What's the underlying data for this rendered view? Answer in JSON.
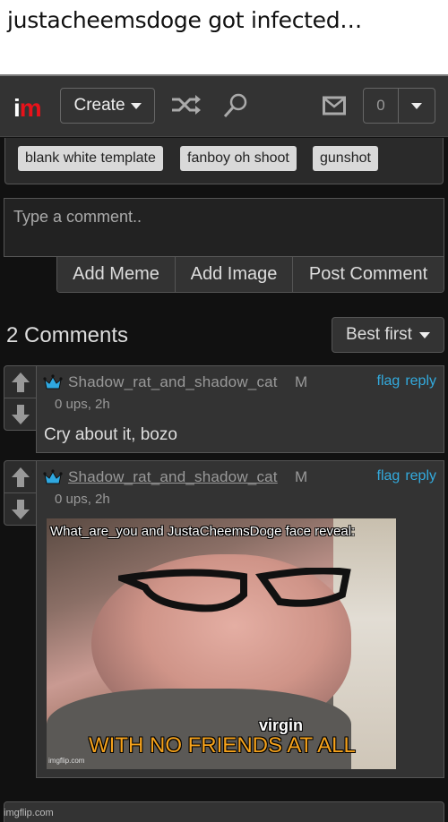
{
  "caption": "justacheemsdoge got infected…",
  "topbar": {
    "logo_i": "i",
    "logo_m": "m",
    "create_label": "Create",
    "icons": [
      "shuffle-icon",
      "search-icon",
      "mail-icon"
    ],
    "notification_count": "0"
  },
  "tags": [
    "blank white template",
    "fanboy oh shoot",
    "gunshot"
  ],
  "comment_form": {
    "placeholder": "Type a comment..",
    "buttons": [
      "Add Meme",
      "Add Image",
      "Post Comment"
    ]
  },
  "comments_header": {
    "count_label": "2 Comments",
    "sort_label": "Best first"
  },
  "comments": [
    {
      "author": "Shadow_rat_and_shadow_cat",
      "role": "M",
      "meta": "0 ups, 2h",
      "text": "Cry about it, bozo",
      "actions": [
        "flag",
        "reply"
      ]
    },
    {
      "author": "Shadow_rat_and_shadow_cat",
      "role": "M",
      "meta": "0 ups, 2h",
      "actions": [
        "flag",
        "reply"
      ],
      "meme": {
        "top_text": "What_are_you and JustaCheemsDoge face reveal:",
        "middle_text": "virgin",
        "bottom_text": "WITH NO FRIENDS AT ALL",
        "watermark": "imgflip.com"
      }
    }
  ],
  "footer_watermark": "imgflip.com",
  "colors": {
    "background": "#111111",
    "panel": "#333333",
    "link": "#33aadd",
    "logo_red": "#e8121a",
    "crown_blue": "#2fa8e0",
    "meme_orange": "#f5a21c"
  }
}
